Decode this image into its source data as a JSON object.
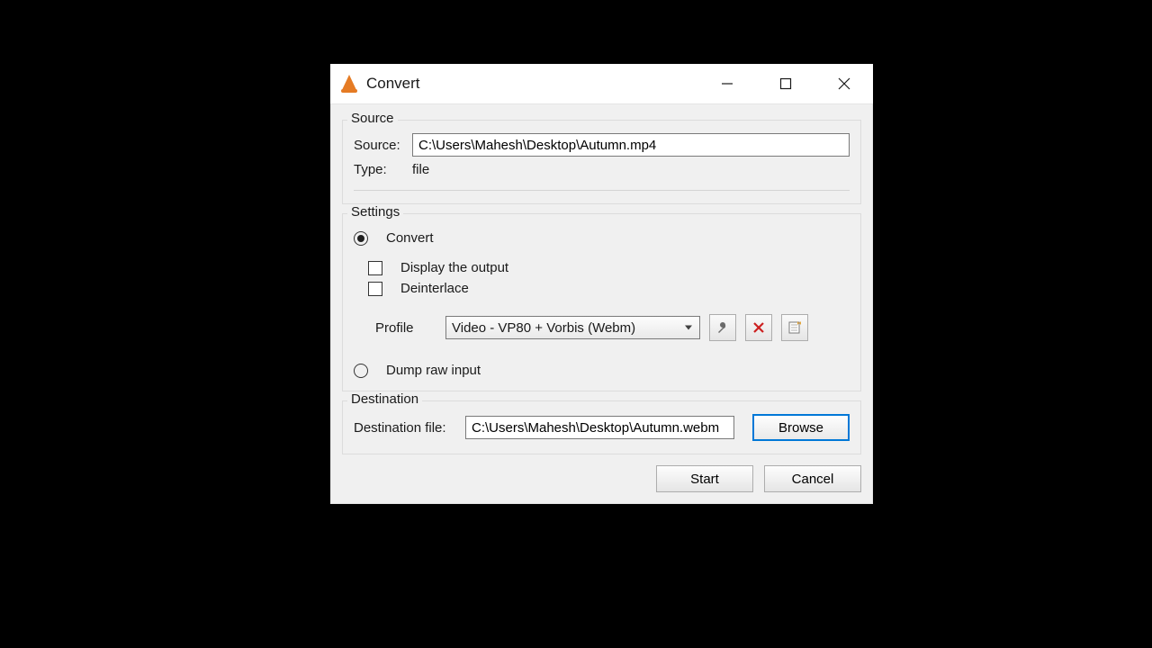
{
  "window": {
    "title": "Convert"
  },
  "source": {
    "legend": "Source",
    "source_label": "Source:",
    "source_value": "C:\\Users\\Mahesh\\Desktop\\Autumn.mp4",
    "type_label": "Type:",
    "type_value": "file"
  },
  "settings": {
    "legend": "Settings",
    "convert_label": "Convert",
    "display_output_label": "Display the output",
    "deinterlace_label": "Deinterlace",
    "profile_label": "Profile",
    "profile_value": "Video - VP80 + Vorbis (Webm)",
    "dump_label": "Dump raw input"
  },
  "destination": {
    "legend": "Destination",
    "dest_file_label": "Destination file:",
    "dest_file_value": "C:\\Users\\Mahesh\\Desktop\\Autumn.webm",
    "browse_label": "Browse"
  },
  "footer": {
    "start_label": "Start",
    "cancel_label": "Cancel"
  }
}
